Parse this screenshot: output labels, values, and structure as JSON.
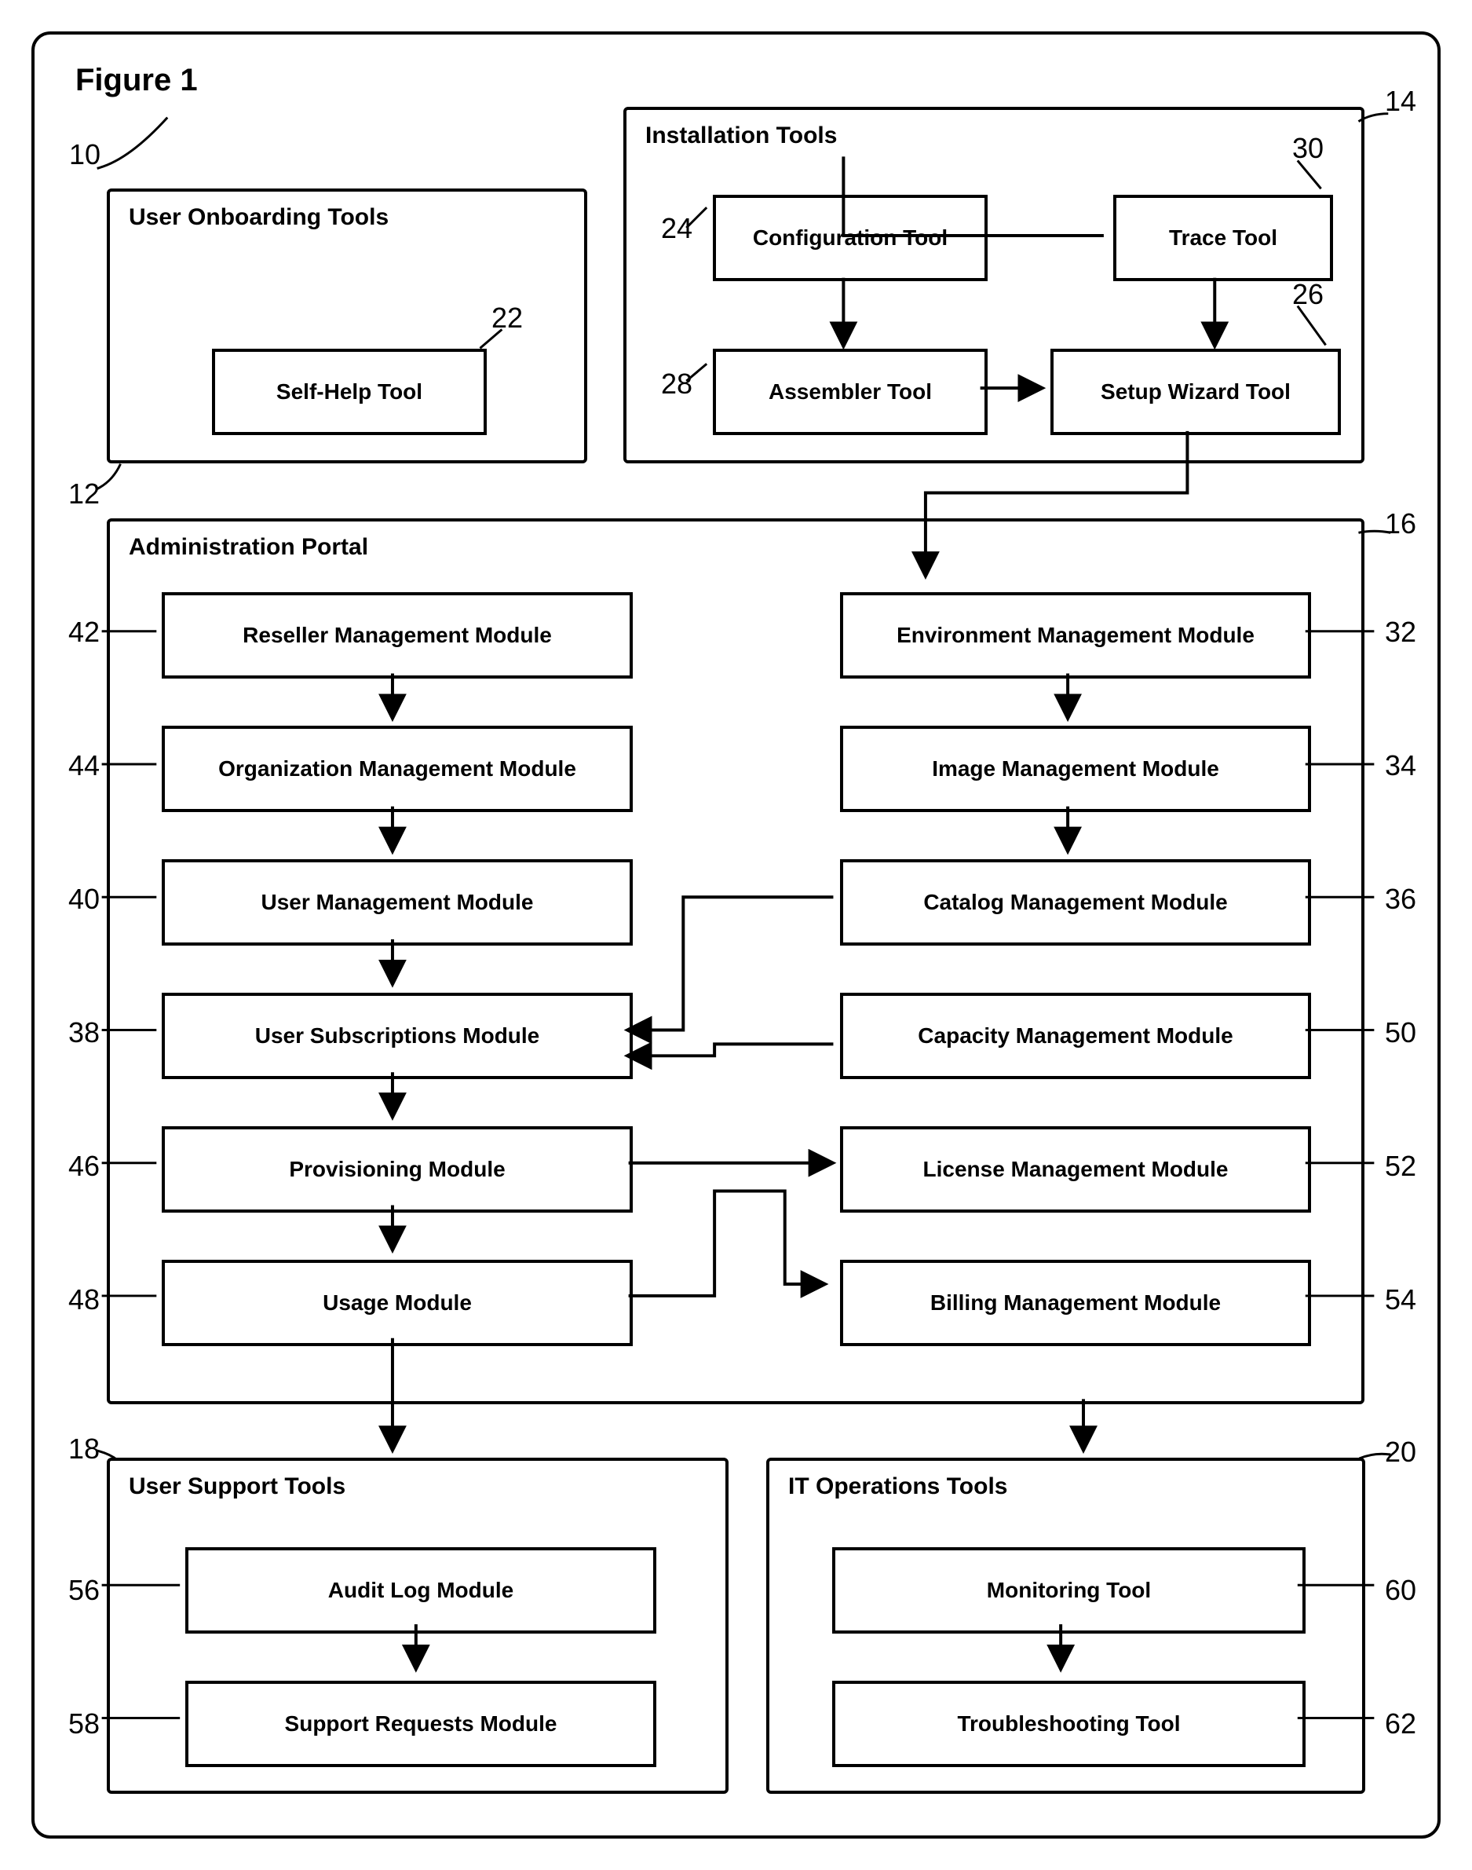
{
  "figure_title": "Figure 1",
  "refs": {
    "r10": "10",
    "r12": "12",
    "r14": "14",
    "r16": "16",
    "r18": "18",
    "r20": "20",
    "r22": "22",
    "r24": "24",
    "r26": "26",
    "r28": "28",
    "r30": "30",
    "r32": "32",
    "r34": "34",
    "r36": "36",
    "r38": "38",
    "r40": "40",
    "r42": "42",
    "r44": "44",
    "r46": "46",
    "r48": "48",
    "r50": "50",
    "r52": "52",
    "r54": "54",
    "r56": "56",
    "r58": "58",
    "r60": "60",
    "r62": "62"
  },
  "panels": {
    "onboarding": "User Onboarding Tools",
    "installation": "Installation Tools",
    "admin": "Administration Portal",
    "usersupport": "User Support Tools",
    "itops": "IT Operations Tools"
  },
  "boxes": {
    "selfhelp": "Self-Help Tool",
    "config": "Configuration Tool",
    "trace": "Trace Tool",
    "assembler": "Assembler Tool",
    "setupwizard": "Setup Wizard Tool",
    "reseller": "Reseller Management Module",
    "org": "Organization Management Module",
    "usermgmt": "User Management Module",
    "usersubs": "User Subscriptions Module",
    "provisioning": "Provisioning Module",
    "usage": "Usage Module",
    "envmgmt": "Environment Management Module",
    "imgmgmt": "Image Management Module",
    "catalog": "Catalog Management Module",
    "capacity": "Capacity Management Module",
    "license": "License Management Module",
    "billing": "Billing Management Module",
    "auditlog": "Audit Log Module",
    "supportreq": "Support Requests Module",
    "monitoring": "Monitoring Tool",
    "trouble": "Troubleshooting Tool"
  }
}
